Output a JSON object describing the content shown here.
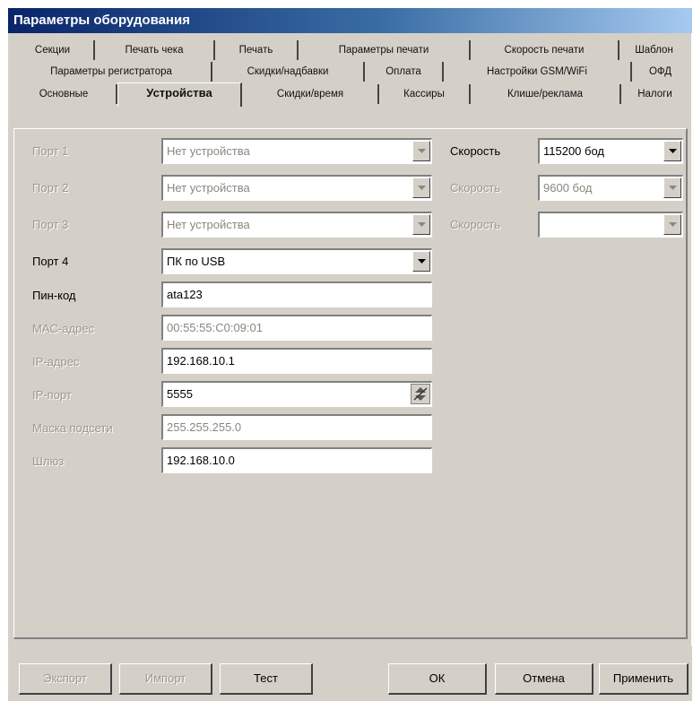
{
  "window": {
    "title": "Параметры оборудования"
  },
  "tabs": {
    "row1": [
      "Секции",
      "Печать чека",
      "Печать",
      "Параметры печати",
      "Скорость печати",
      "Шаблон"
    ],
    "row2": [
      "Параметры регистратора",
      "Скидки/надбавки",
      "Оплата",
      "Настройки GSM/WiFi",
      "ОФД"
    ],
    "row3": [
      "Основные",
      "Устройства",
      "Скидки/время",
      "Кассиры",
      "Клише/реклама",
      "Налоги"
    ],
    "selected": "Устройства"
  },
  "form": {
    "port1": {
      "label": "Порт 1",
      "value": "Нет устройства",
      "speed_label": "Скорость",
      "speed": "115200 бод"
    },
    "port2": {
      "label": "Порт 2",
      "value": "Нет устройства",
      "speed_label": "Скорость",
      "speed": "9600 бод"
    },
    "port3": {
      "label": "Порт 3",
      "value": "Нет устройства",
      "speed_label": "Скорость",
      "speed": ""
    },
    "port4": {
      "label": "Порт 4",
      "value": "ПК по USB"
    },
    "pin": {
      "label": "Пин-код",
      "value": "ata123"
    },
    "mac": {
      "label": "MAC-адрес",
      "value": "00:55:55:C0:09:01"
    },
    "ip": {
      "label": "IP-адрес",
      "value": "192.168.10.1"
    },
    "ipport": {
      "label": "IP-порт",
      "value": "5555"
    },
    "mask": {
      "label": "Маска подсети",
      "value": "255.255.255.0"
    },
    "gateway": {
      "label": "Шлюз",
      "value": "192.168.10.0"
    }
  },
  "buttons": {
    "export": "Экспорт",
    "import": "Импорт",
    "test": "Тест",
    "ok": "ОК",
    "cancel": "Отмена",
    "apply": "Применить"
  }
}
